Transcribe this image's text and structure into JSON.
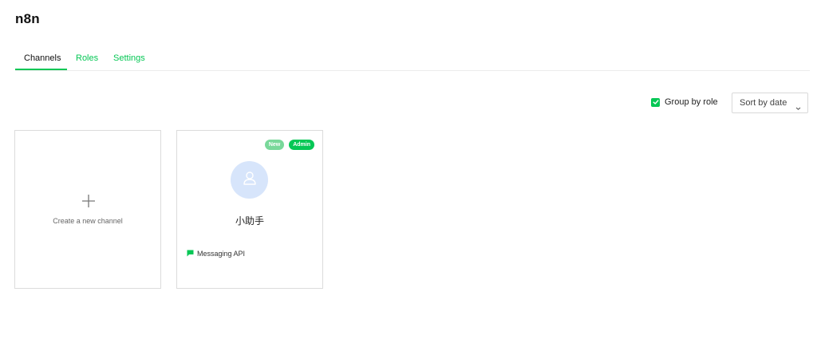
{
  "app": {
    "title": "n8n"
  },
  "tabs": [
    {
      "label": "Channels",
      "active": true
    },
    {
      "label": "Roles",
      "active": false
    },
    {
      "label": "Settings",
      "active": false
    }
  ],
  "toolbar": {
    "group_by_role": {
      "label": "Group by role",
      "checked": true
    },
    "sort": {
      "selected": "Sort by date"
    }
  },
  "create_card": {
    "label": "Create a new channel",
    "icon": "plus-icon"
  },
  "channels": [
    {
      "name": "小助手",
      "type": "Messaging API",
      "badges": [
        "New",
        "Admin"
      ],
      "avatar_icon": "user-icon",
      "type_icon": "chat-bubble-icon"
    }
  ],
  "colors": {
    "accent": "#06c755",
    "badge_new": "#79d89a",
    "avatar_bg": "#d7e5fb"
  }
}
